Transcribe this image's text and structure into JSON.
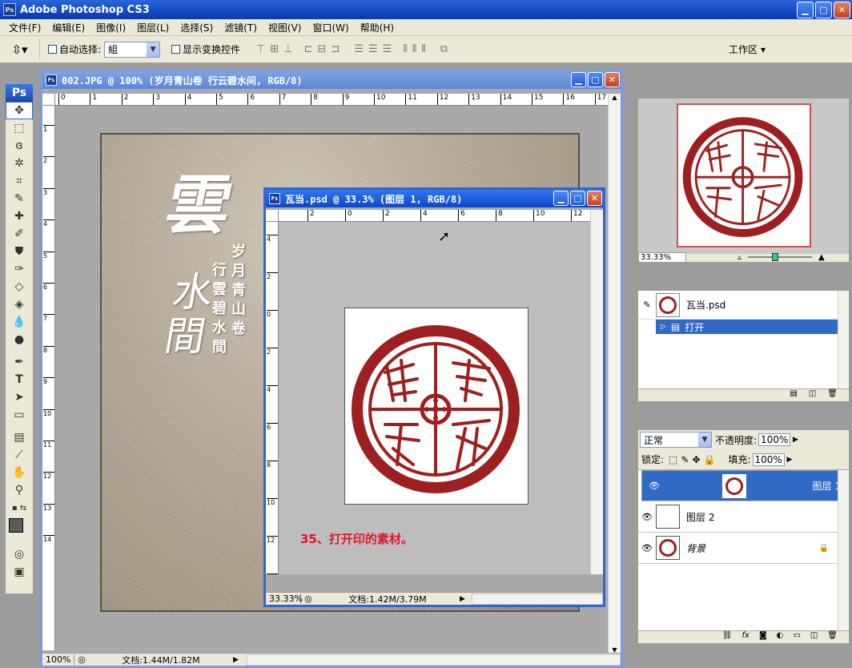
{
  "app": {
    "icon": "Ps",
    "title": "Adobe Photoshop CS3"
  },
  "menu": [
    "文件(F)",
    "编辑(E)",
    "图像(I)",
    "图层(L)",
    "选择(S)",
    "滤镜(T)",
    "视图(V)",
    "窗口(W)",
    "帮助(H)"
  ],
  "options": {
    "auto_select_label": "自动选择:",
    "auto_select_value": "組",
    "show_transform_label": "显示变换控件",
    "workspace_label": "工作区"
  },
  "toolbox": {
    "logo": "Ps"
  },
  "doc1": {
    "title": "002.JPG @ 100% (岁月青山卷  行云碧水间, RGB/8)",
    "zoom": "100%",
    "file_info": "文档:1.44M/1.82M",
    "ruler_h": [
      "0",
      "1",
      "2",
      "3",
      "4",
      "5",
      "6",
      "7",
      "8",
      "9",
      "10",
      "11",
      "12",
      "13",
      "14",
      "15",
      "16",
      "17"
    ],
    "ruler_v": [
      "1",
      "2",
      "3",
      "4",
      "5",
      "6",
      "7",
      "8",
      "9",
      "10",
      "11",
      "12",
      "13",
      "14"
    ],
    "art_col1": [
      "岁",
      "月",
      "青",
      "山",
      "卷"
    ],
    "art_col2": [
      "行",
      "雲",
      "碧",
      "水",
      "間"
    ]
  },
  "doc2": {
    "title": "瓦当.psd @ 33.3% (图层 1, RGB/8)",
    "zoom": "33.33%",
    "file_info": "文档:1.42M/3.79M",
    "ruler_h": [
      "2",
      "0",
      "2",
      "4",
      "6",
      "8",
      "10",
      "12"
    ],
    "ruler_v": [
      "4",
      "2",
      "0",
      "2",
      "4",
      "6",
      "8",
      "10",
      "12",
      "14"
    ],
    "caption": "35、打开印的素材。"
  },
  "navigator": {
    "zoom": "33.33%"
  },
  "history": {
    "source": "瓦当.psd",
    "items": [
      "打开"
    ]
  },
  "layers": {
    "blend_mode": "正常",
    "opacity_label": "不透明度:",
    "opacity": "100%",
    "lock_label": "锁定:",
    "fill_label": "填充:",
    "fill": "100%",
    "items": [
      {
        "name": "图层 1",
        "selected": true
      },
      {
        "name": "图层 2",
        "selected": false
      },
      {
        "name": "背景",
        "selected": false,
        "locked": true
      }
    ]
  },
  "colors": {
    "accent": "#316ac5",
    "seal": "#9e1f1f",
    "titlebar": "#1447c2"
  }
}
